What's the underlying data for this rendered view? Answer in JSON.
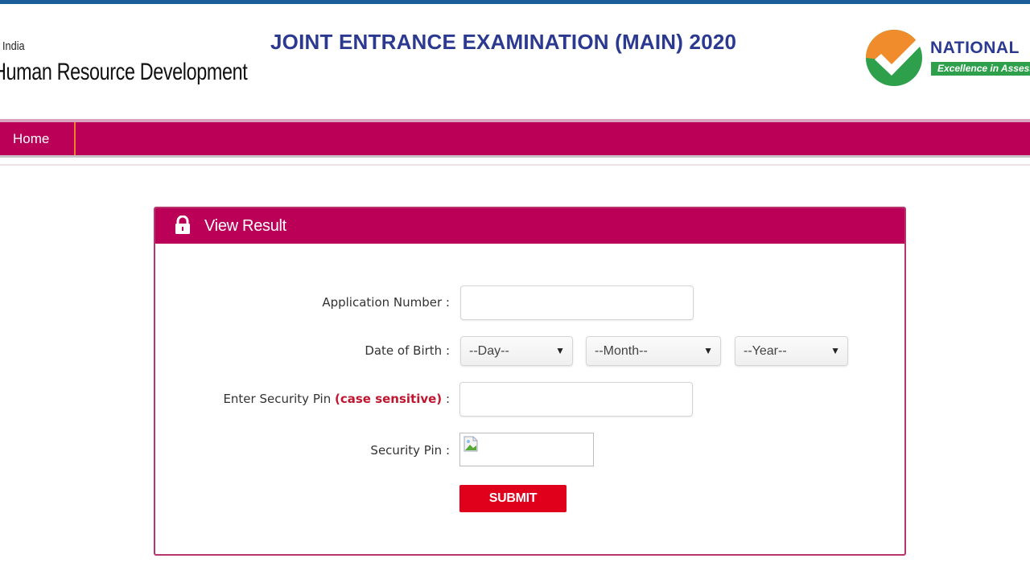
{
  "header": {
    "ministry_line1": "India",
    "ministry_line2": "Human Resource Development",
    "title": "JOINT ENTRANCE EXAMINATION (MAIN) 2020",
    "agency_logo": {
      "name": "NATIONAL",
      "tagline": "Excellence in Assessment",
      "colors": {
        "orange": "#f08c2c",
        "green": "#2ea04b",
        "navy": "#2b3990"
      }
    }
  },
  "nav": {
    "items": [
      {
        "label": "Home"
      }
    ]
  },
  "panel": {
    "icon": "lock-icon",
    "title": "View Result",
    "fields": {
      "application_number": {
        "label": "Application Number :",
        "value": "",
        "placeholder": ""
      },
      "dob": {
        "label": "Date of Birth :",
        "day": "--Day--",
        "month": "--Month--",
        "year": "--Year--"
      },
      "security_pin_input": {
        "label_prefix": "Enter Security Pin ",
        "label_note": "(case sensitive)",
        "label_suffix": " :",
        "value": ""
      },
      "security_pin_image": {
        "label": "Security Pin :",
        "icon": "broken-image-icon"
      }
    },
    "submit_label": "SUBMIT"
  },
  "colors": {
    "brand_magenta": "#bb0058",
    "top_bar_blue": "#1b5c9a",
    "submit_red": "#e0001b",
    "note_red": "#c0152f",
    "nav_divider_orange": "#f08030"
  }
}
